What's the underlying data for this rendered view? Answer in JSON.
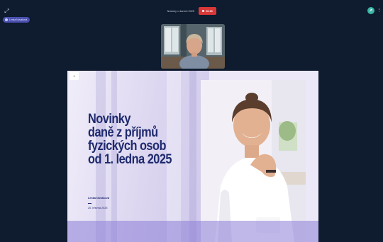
{
  "topbar": {
    "expand_icon": "expand-arrows-icon",
    "presenter_name": "Lenka Nováková",
    "meeting_title": "Novinky v daních 2025",
    "recording_time": "00:15",
    "share_icon": "share-screen-icon",
    "more_icon": "more-vertical-icon"
  },
  "colors": {
    "background": "#0f1b2e",
    "recording": "#d93838",
    "presenter_chip": "#4a4fb0",
    "share": "#3ab6a6",
    "slide_title": "#1f2a6e"
  },
  "slide": {
    "page_number": "1",
    "title_lines": [
      "Novinky",
      "daně z příjmů",
      "fyzických osob",
      "od 1. ledna 2025"
    ],
    "author": "Lenka Nováková",
    "date": "20. března 2025"
  }
}
